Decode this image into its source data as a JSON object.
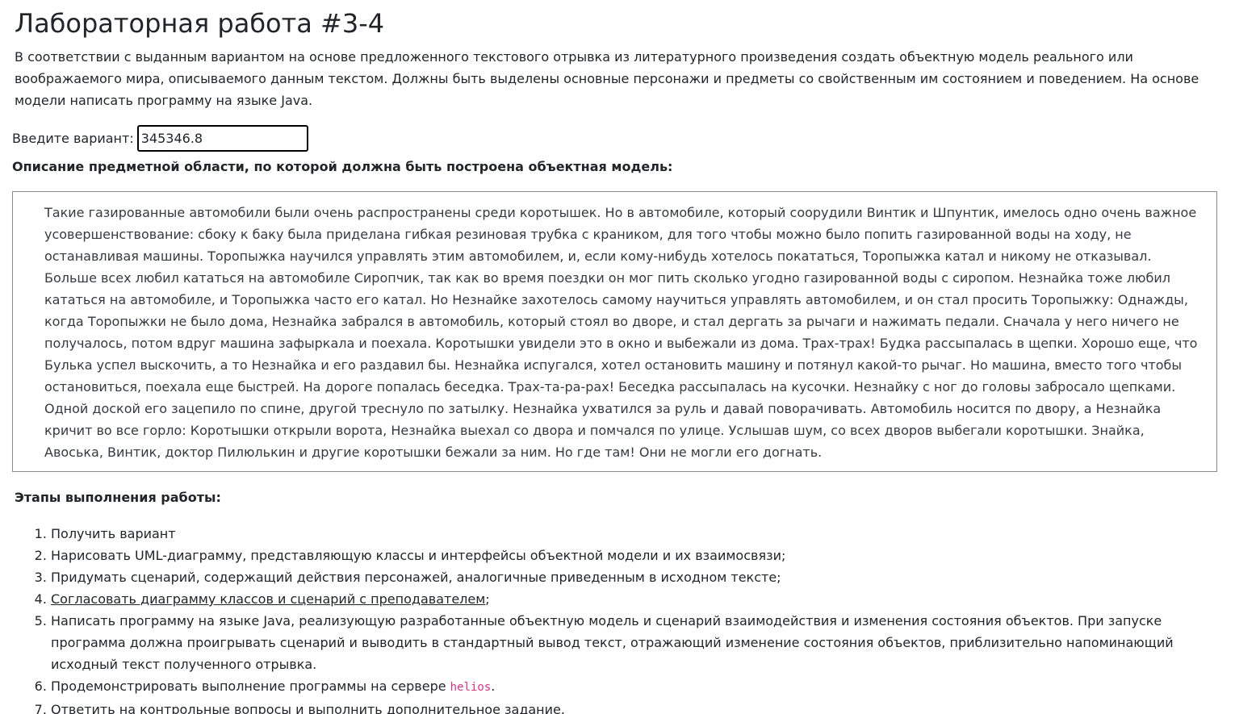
{
  "page": {
    "title": "Лабораторная работа #3-4",
    "intro": "В соответствии с выданным вариантом на основе предложенного текстового отрывка из литературного произведения создать объектную модель реального или воображаемого мира, описываемого данным текстом. Должны быть выделены основные персонажи и предметы со свойственным им состоянием и поведением. На основе модели написать программу на языке Java."
  },
  "variant": {
    "label": "Введите вариант:",
    "value": "345346.8"
  },
  "description": {
    "heading": "Описание предметной области, по которой должна быть построена объектная модель:",
    "text": "Такие газированные автомобили были очень распространены среди коротышек. Но в автомобиле, который соорудили Винтик и Шпунтик, имелось одно очень важное усовершенствование: сбоку к баку была приделана гибкая резиновая трубка с краником, для того чтобы можно было попить газированной воды на ходу, не останавливая машины. Торопыжка научился управлять этим автомобилем, и, если кому-нибудь хотелось покататься, Торопыжка катал и никому не отказывал. Больше всех любил кататься на автомобиле Сиропчик, так как во время поездки он мог пить сколько угодно газированной воды с сиропом. Незнайка тоже любил кататься на автомобиле, и Торопыжка часто его катал. Но Незнайке захотелось самому научиться управлять автомобилем, и он стал просить Торопыжку: Однажды, когда Торопыжки не было дома, Незнайка забрался в автомобиль, который стоял во дворе, и стал дергать за рычаги и нажимать педали. Сначала у него ничего не получалось, потом вдруг машина зафыркала и поехала. Коротышки увидели это в окно и выбежали из дома. Трах-трах! Будка рассыпалась в щепки. Хорошо еще, что Булька успел выскочить, а то Незнайка и его раздавил бы. Незнайка испугался, хотел остановить машину и потянул какой-то рычаг. Но машина, вместо того чтобы остановиться, поехала еще быстрей. На дороге попалась беседка. Трах-та-ра-рах! Беседка рассыпалась на кусочки. Незнайку с ног до головы забросало щепками. Одной доской его зацепило по спине, другой треснуло по затылку. Незнайка ухватился за руль и давай поворачивать. Автомобиль носится по двору, а Незнайка кричит во все горло: Коротышки открыли ворота, Незнайка выехал со двора и помчался по улице. Услышав шум, со всех дворов выбегали коротышки. Знайка, Авоська, Винтик, доктор Пилюлькин и другие коротышки бежали за ним. Но где там! Они не могли его догнать."
  },
  "steps": {
    "heading": "Этапы выполнения работы:",
    "items": [
      {
        "text": "Получить вариант"
      },
      {
        "text": "Нарисовать UML-диаграмму, представляющую классы и интерфейсы объектной модели и их взаимосвязи;"
      },
      {
        "text": "Придумать сценарий, содержащий действия персонажей, аналогичные приведенным в исходном тексте;"
      },
      {
        "link": "Согласовать диаграмму классов и сценарий с преподавателем",
        "suffix": ";"
      },
      {
        "text": "Написать программу на языке Java, реализующую разработанные объектную модель и сценарий взаимодействия и изменения состояния объектов. При запуске программа должна проигрывать сценарий и выводить в стандартный вывод текст, отражающий изменение состояния объектов, приблизительно напоминающий исходный текст полученного отрывка."
      },
      {
        "text": "Продемонстрировать выполнение программы на сервере ",
        "code": "helios",
        "suffix": "."
      },
      {
        "text": "Ответить на контрольные вопросы и выполнить дополнительное задание."
      }
    ]
  }
}
